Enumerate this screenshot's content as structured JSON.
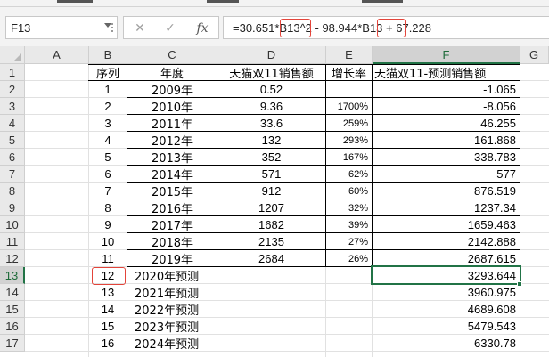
{
  "formula_bar": {
    "name_box": "F13",
    "cancel_icon": "✕",
    "enter_icon": "✓",
    "fx_label": "fx",
    "formula_parts": [
      "=30.651*",
      "B13",
      "^2 - 98.944*",
      "B13",
      " + 67.228"
    ]
  },
  "columns": [
    "A",
    "B",
    "C",
    "D",
    "E",
    "F",
    "G"
  ],
  "rows": [
    "1",
    "2",
    "3",
    "4",
    "5",
    "6",
    "7",
    "8",
    "9",
    "10",
    "11",
    "12",
    "13",
    "14",
    "15",
    "16",
    "17"
  ],
  "header": {
    "b": "序列",
    "c": "年度",
    "d": "天猫双11销售额",
    "e": "增长率",
    "f": "天猫双11-预测销售额"
  },
  "table": [
    {
      "seq": "1",
      "year": "2009年",
      "sales": "0.52",
      "growth": "",
      "pred": "-1.065"
    },
    {
      "seq": "2",
      "year": "2010年",
      "sales": "9.36",
      "growth": "1700%",
      "pred": "-8.056"
    },
    {
      "seq": "3",
      "year": "2011年",
      "sales": "33.6",
      "growth": "259%",
      "pred": "46.255"
    },
    {
      "seq": "4",
      "year": "2012年",
      "sales": "132",
      "growth": "293%",
      "pred": "161.868"
    },
    {
      "seq": "5",
      "year": "2013年",
      "sales": "352",
      "growth": "167%",
      "pred": "338.783"
    },
    {
      "seq": "6",
      "year": "2014年",
      "sales": "571",
      "growth": "62%",
      "pred": "577"
    },
    {
      "seq": "7",
      "year": "2015年",
      "sales": "912",
      "growth": "60%",
      "pred": "876.519"
    },
    {
      "seq": "8",
      "year": "2016年",
      "sales": "1207",
      "growth": "32%",
      "pred": "1237.34"
    },
    {
      "seq": "9",
      "year": "2017年",
      "sales": "1682",
      "growth": "39%",
      "pred": "1659.463"
    },
    {
      "seq": "10",
      "year": "2018年",
      "sales": "2135",
      "growth": "27%",
      "pred": "2142.888"
    },
    {
      "seq": "11",
      "year": "2019年",
      "sales": "2684",
      "growth": "26%",
      "pred": "2687.615"
    }
  ],
  "forecast": [
    {
      "seq": "12",
      "year": "2020年预测",
      "pred": "3293.644"
    },
    {
      "seq": "13",
      "year": "2021年预测",
      "pred": "3960.975"
    },
    {
      "seq": "14",
      "year": "2022年预测",
      "pred": "4689.608"
    },
    {
      "seq": "15",
      "year": "2023年预测",
      "pred": "5479.543"
    },
    {
      "seq": "16",
      "year": "2024年预测",
      "pred": "6330.78"
    }
  ],
  "colors": {
    "selection_green": "#217346",
    "highlight_red": "#e3443a",
    "header_gray": "#e9e9e9"
  }
}
